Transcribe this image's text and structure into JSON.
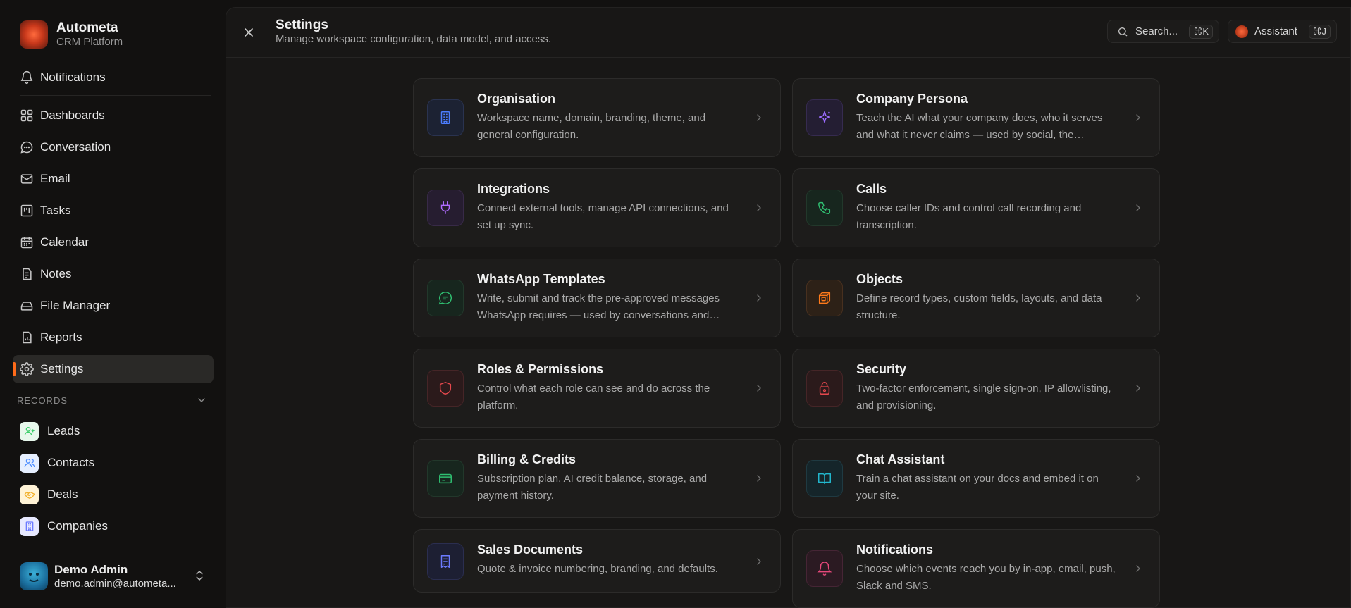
{
  "brand": {
    "name": "Autometa",
    "subtitle": "CRM Platform"
  },
  "sidebar": {
    "notifications": "Notifications",
    "items": [
      {
        "label": "Dashboards",
        "icon": "dashboard-grid-icon"
      },
      {
        "label": "Conversation",
        "icon": "chat-bubble-icon"
      },
      {
        "label": "Email",
        "icon": "mail-icon"
      },
      {
        "label": "Tasks",
        "icon": "kanban-icon"
      },
      {
        "label": "Calendar",
        "icon": "calendar-icon"
      },
      {
        "label": "Notes",
        "icon": "notes-icon"
      },
      {
        "label": "File Manager",
        "icon": "hard-drive-icon"
      },
      {
        "label": "Reports",
        "icon": "report-icon"
      },
      {
        "label": "Settings",
        "icon": "gear-icon",
        "active": true
      }
    ],
    "records_title": "RECORDS",
    "records": [
      {
        "label": "Leads",
        "icon": "user-plus-icon",
        "color": "#3ecf6b"
      },
      {
        "label": "Contacts",
        "icon": "users-icon",
        "color": "#4c8dff"
      },
      {
        "label": "Deals",
        "icon": "handshake-icon",
        "color": "#f2b02b"
      },
      {
        "label": "Companies",
        "icon": "building-icon",
        "color": "#6c7bff"
      }
    ],
    "accent_color": "#ff6b1a"
  },
  "user": {
    "name": "Demo Admin",
    "email": "demo.admin@autometa..."
  },
  "header": {
    "title": "Settings",
    "subtitle": "Manage workspace configuration, data model, and access.",
    "search_label": "Search...",
    "search_shortcut": "⌘K",
    "assistant_label": "Assistant",
    "assistant_shortcut": "⌘J"
  },
  "cards": [
    {
      "title": "Organisation",
      "desc": "Workspace name, domain, branding, theme, and general configuration.",
      "icon": "building-icon",
      "color": "#4c7dff"
    },
    {
      "title": "Company Persona",
      "desc": "Teach the AI what your company does, who it serves and what it never claims — used by social, the…",
      "icon": "sparkle-icon",
      "color": "#9b6bff"
    },
    {
      "title": "Integrations",
      "desc": "Connect external tools, manage API connections, and set up sync.",
      "icon": "plug-icon",
      "color": "#b06bff"
    },
    {
      "title": "Calls",
      "desc": "Choose caller IDs and control call recording and transcription.",
      "icon": "phone-icon",
      "color": "#2fbf71"
    },
    {
      "title": "WhatsApp Templates",
      "desc": "Write, submit and track the pre-approved messages WhatsApp requires — used by conversations and…",
      "icon": "whatsapp-icon",
      "color": "#2fbf71"
    },
    {
      "title": "Objects",
      "desc": "Define record types, custom fields, layouts, and data structure.",
      "icon": "cube-icon",
      "color": "#ff7a1a"
    },
    {
      "title": "Roles & Permissions",
      "desc": "Control what each role can see and do across the platform.",
      "icon": "shield-icon",
      "color": "#e5484d"
    },
    {
      "title": "Security",
      "desc": "Two-factor enforcement, single sign-on, IP allowlisting, and provisioning.",
      "icon": "lock-icon",
      "color": "#e5484d"
    },
    {
      "title": "Billing & Credits",
      "desc": "Subscription plan, AI credit balance, storage, and payment history.",
      "icon": "credit-card-icon",
      "color": "#2fbf71"
    },
    {
      "title": "Chat Assistant",
      "desc": "Train a chat assistant on your docs and embed it on your site.",
      "icon": "book-open-icon",
      "color": "#22b8cf"
    },
    {
      "title": "Sales Documents",
      "desc": "Quote & invoice numbering, branding, and defaults.",
      "icon": "receipt-icon",
      "color": "#6c7bff"
    },
    {
      "title": "Notifications",
      "desc": "Choose which events reach you by in-app, email, push, Slack and SMS.",
      "icon": "bell-icon",
      "color": "#e5487a"
    }
  ]
}
